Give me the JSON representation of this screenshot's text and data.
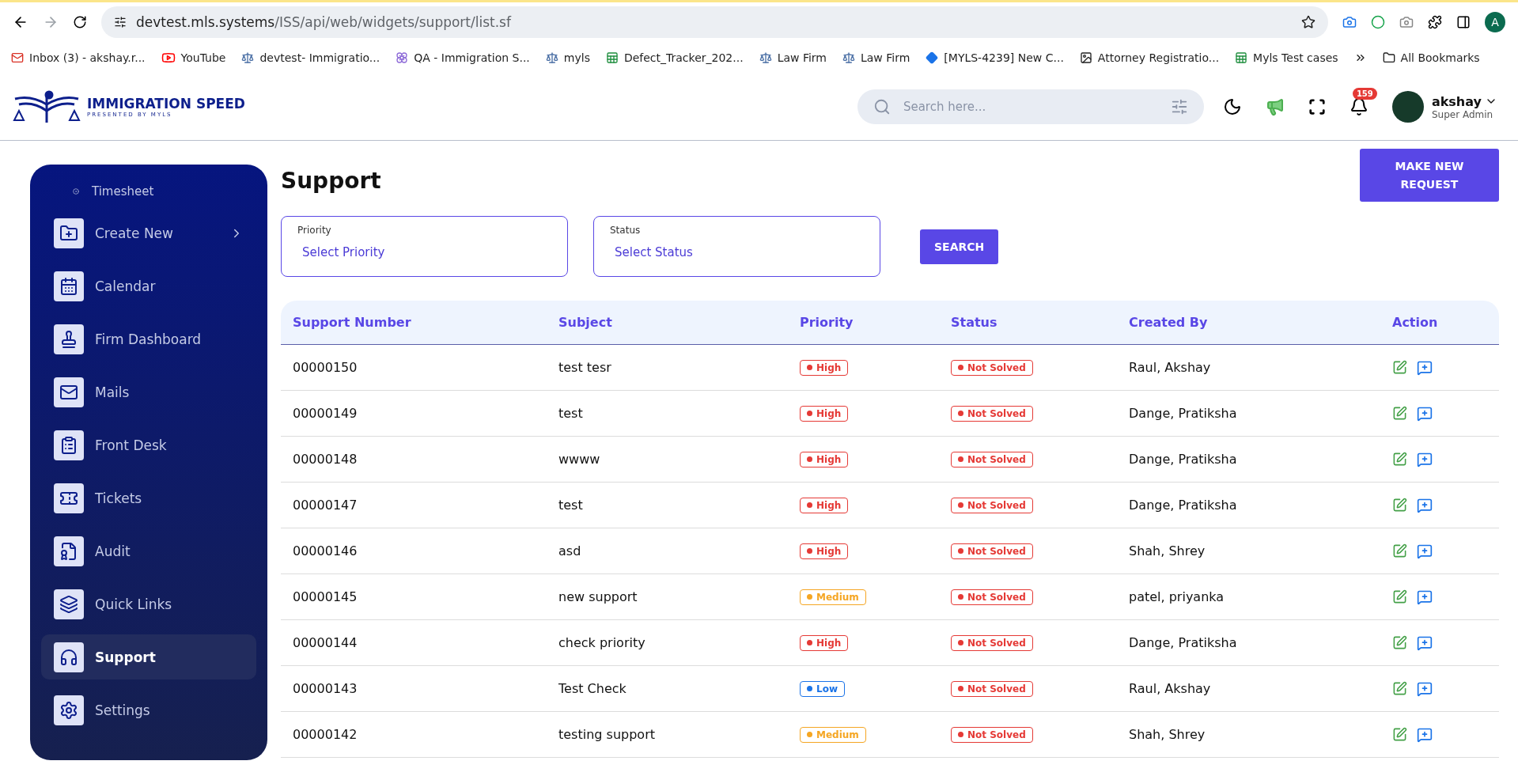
{
  "browser": {
    "url_host": "devtest.mls.systems",
    "url_path": "/ISS/api/web/widgets/support/list.sf",
    "profile_initial": "A",
    "bookmarks": [
      {
        "label": "Inbox (3) - akshay.r...",
        "kind": "gmail"
      },
      {
        "label": "YouTube",
        "kind": "youtube"
      },
      {
        "label": "devtest- Immigratio...",
        "kind": "scale"
      },
      {
        "label": "QA - Immigration S...",
        "kind": "flower"
      },
      {
        "label": "myls",
        "kind": "scale"
      },
      {
        "label": "Defect_Tracker_202...",
        "kind": "sheet"
      },
      {
        "label": "Law Firm",
        "kind": "scale"
      },
      {
        "label": "Law Firm",
        "kind": "scale"
      },
      {
        "label": "[MYLS-4239] New C...",
        "kind": "diamond"
      },
      {
        "label": "Attorney Registratio...",
        "kind": "photo"
      },
      {
        "label": "Myls Test cases",
        "kind": "sheet"
      }
    ],
    "all_bookmarks": "All Bookmarks"
  },
  "header": {
    "logo_title": "IMMIGRATION SPEED",
    "logo_subtitle": "PRESENTED BY MYLS",
    "search": {
      "placeholder": "Search here..."
    },
    "notification_count": "159",
    "user": {
      "name": "akshay",
      "role": "Super Admin"
    }
  },
  "sidebar": {
    "items": [
      {
        "label": "Timesheet",
        "kind": "subitem",
        "selected": false
      },
      {
        "label": "Create New",
        "kind": "create",
        "selected": false,
        "expandable": true
      },
      {
        "label": "Calendar",
        "kind": "calendar",
        "selected": false
      },
      {
        "label": "Firm Dashboard",
        "kind": "stamp",
        "selected": false
      },
      {
        "label": "Mails",
        "kind": "mail",
        "selected": false
      },
      {
        "label": "Front Desk",
        "kind": "clipboard",
        "selected": false
      },
      {
        "label": "Tickets",
        "kind": "ticket",
        "selected": false
      },
      {
        "label": "Audit",
        "kind": "audit",
        "selected": false
      },
      {
        "label": "Quick Links",
        "kind": "layers",
        "selected": false
      },
      {
        "label": "Support",
        "kind": "support",
        "selected": true
      },
      {
        "label": "Settings",
        "kind": "settings",
        "selected": false
      }
    ]
  },
  "page": {
    "title": "Support",
    "new_button": "MAKE NEW REQUEST",
    "filters": [
      {
        "label": "Priority",
        "placeholder": "Select Priority"
      },
      {
        "label": "Status",
        "placeholder": "Select Status"
      }
    ],
    "search_button": "SEARCH"
  },
  "table": {
    "columns": [
      "Support Number",
      "Subject",
      "Priority",
      "Status",
      "Created By",
      "Action"
    ],
    "rows": [
      {
        "number": "00000150",
        "subject": "test tesr",
        "priority": {
          "label": "High",
          "color": "#e53935"
        },
        "status": {
          "label": "Not Solved",
          "color": "#e53935"
        },
        "created_by": "Raul, Akshay"
      },
      {
        "number": "00000149",
        "subject": "test",
        "priority": {
          "label": "High",
          "color": "#e53935"
        },
        "status": {
          "label": "Not Solved",
          "color": "#e53935"
        },
        "created_by": "Dange, Pratiksha"
      },
      {
        "number": "00000148",
        "subject": "wwww",
        "priority": {
          "label": "High",
          "color": "#e53935"
        },
        "status": {
          "label": "Not Solved",
          "color": "#e53935"
        },
        "created_by": "Dange, Pratiksha"
      },
      {
        "number": "00000147",
        "subject": "test",
        "priority": {
          "label": "High",
          "color": "#e53935"
        },
        "status": {
          "label": "Not Solved",
          "color": "#e53935"
        },
        "created_by": "Dange, Pratiksha"
      },
      {
        "number": "00000146",
        "subject": "asd",
        "priority": {
          "label": "High",
          "color": "#e53935"
        },
        "status": {
          "label": "Not Solved",
          "color": "#e53935"
        },
        "created_by": "Shah, Shrey"
      },
      {
        "number": "00000145",
        "subject": "new support",
        "priority": {
          "label": "Medium",
          "color": "#f5a623"
        },
        "status": {
          "label": "Not Solved",
          "color": "#e53935"
        },
        "created_by": "patel, priyanka"
      },
      {
        "number": "00000144",
        "subject": "check priority",
        "priority": {
          "label": "High",
          "color": "#e53935"
        },
        "status": {
          "label": "Not Solved",
          "color": "#e53935"
        },
        "created_by": "Dange, Pratiksha"
      },
      {
        "number": "00000143",
        "subject": "Test Check",
        "priority": {
          "label": "Low",
          "color": "#1a73e8"
        },
        "status": {
          "label": "Not Solved",
          "color": "#e53935"
        },
        "created_by": "Raul, Akshay"
      },
      {
        "number": "00000142",
        "subject": "testing support",
        "priority": {
          "label": "Medium",
          "color": "#f5a623"
        },
        "status": {
          "label": "Not Solved",
          "color": "#e53935"
        },
        "created_by": "Shah, Shrey"
      }
    ]
  }
}
